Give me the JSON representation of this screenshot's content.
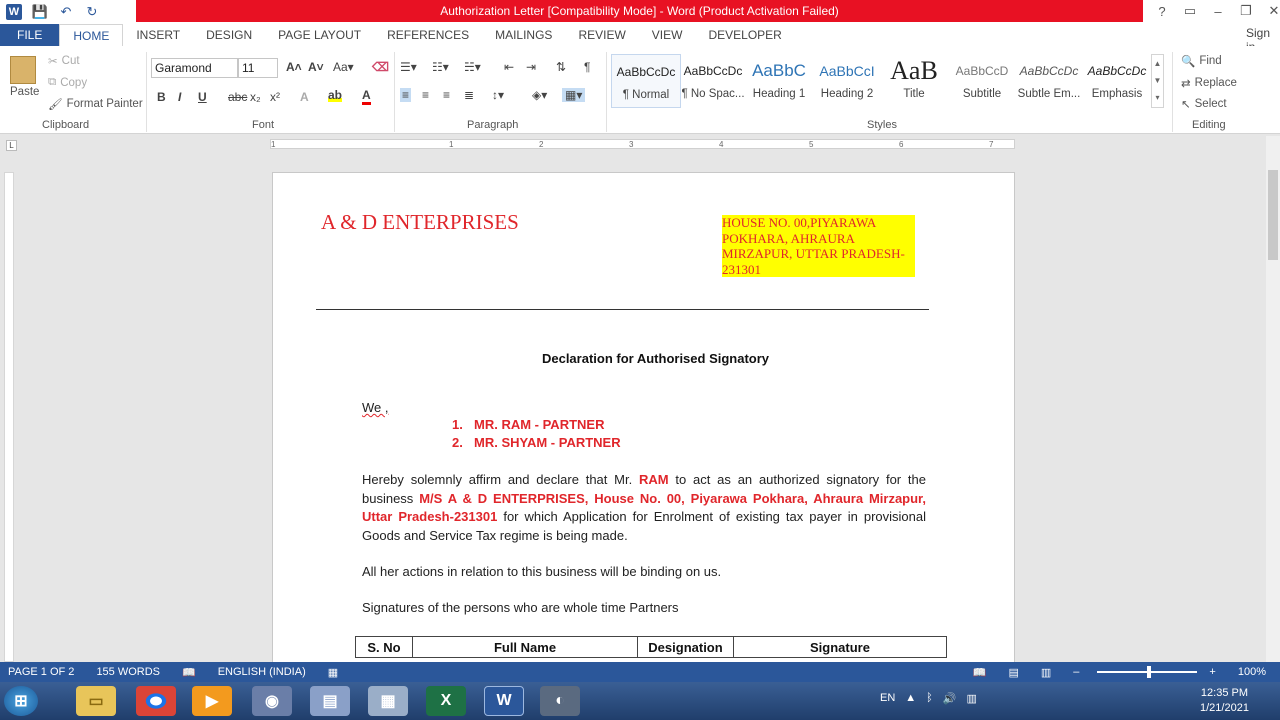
{
  "window": {
    "title": "Authorization Letter [Compatibility Mode] - Word (Product Activation Failed)",
    "controls": [
      "?",
      "▭",
      "–",
      "❐",
      "✕"
    ]
  },
  "qat": {
    "logo": "W",
    "save": "💾",
    "undo": "↶",
    "redo": "↻"
  },
  "tabs": [
    {
      "label": "FILE"
    },
    {
      "label": "HOME"
    },
    {
      "label": "INSERT"
    },
    {
      "label": "DESIGN"
    },
    {
      "label": "PAGE LAYOUT"
    },
    {
      "label": "REFERENCES"
    },
    {
      "label": "MAILINGS"
    },
    {
      "label": "REVIEW"
    },
    {
      "label": "VIEW"
    },
    {
      "label": "DEVELOPER"
    }
  ],
  "signin": "Sign in",
  "clipboard": {
    "label": "Clipboard",
    "paste": "Paste",
    "cut": "Cut",
    "copy": "Copy",
    "format_painter": "Format Painter"
  },
  "font": {
    "label": "Font",
    "name": "Garamond",
    "size": "11"
  },
  "paragraph": {
    "label": "Paragraph"
  },
  "styles": {
    "label": "Styles",
    "items": [
      {
        "preview": "AaBbCcDc",
        "name": "¶ Normal"
      },
      {
        "preview": "AaBbCcDc",
        "name": "¶ No Spac..."
      },
      {
        "preview": "AaBbC",
        "name": "Heading 1"
      },
      {
        "preview": "AaBbCcI",
        "name": "Heading 2"
      },
      {
        "preview": "AaB",
        "name": "Title"
      },
      {
        "preview": "AaBbCcD",
        "name": "Subtitle"
      },
      {
        "preview": "AaBbCcDc",
        "name": "Subtle Em..."
      },
      {
        "preview": "AaBbCcDc",
        "name": "Emphasis"
      }
    ]
  },
  "editing": {
    "label": "Editing",
    "find": "Find",
    "replace": "Replace",
    "select": "Select"
  },
  "ruler": {
    "numbers": [
      "1",
      "1",
      "2",
      "3",
      "4",
      "5",
      "6",
      "7"
    ]
  },
  "document": {
    "company": "A & D ENTERPRISES",
    "address": "HOUSE NO. 00,PIYARAWA POKHARA, AHRAURA MIRZAPUR, UTTAR PRADESH-231301",
    "heading": "Declaration for Authorised Signatory",
    "we": "We ,",
    "list": [
      {
        "num": "1.",
        "text": "MR. RAM -  PARTNER"
      },
      {
        "num": "2.",
        "text": "MR. SHYAM - PARTNER"
      }
    ],
    "p1a": "Hereby solemnly affirm and declare that Mr. ",
    "p1b": "RAM",
    "p1c": " to act as an authorized signatory for the business ",
    "p1d": "M/S A & D ENTERPRISES, House No. 00, Piyarawa Pokhara, Ahraura Mirzapur, Uttar Pradesh-231301",
    "p1e": " for which Application for Enrolment of existing tax payer in provisional Goods and Service Tax regime is being made.",
    "p2": "All her actions in relation to this business will be binding on us.",
    "p3": "Signatures of the persons who are whole time Partners",
    "table_headers": [
      "S. No",
      "Full Name",
      "Designation",
      "Signature"
    ]
  },
  "status": {
    "page": "PAGE 1 OF 2",
    "words": "155 WORDS",
    "language": "ENGLISH (INDIA)",
    "zoom": "100%"
  },
  "taskbar": {
    "clock_time": "12:35 PM",
    "clock_date": "1/21/2021",
    "lang": "EN"
  }
}
